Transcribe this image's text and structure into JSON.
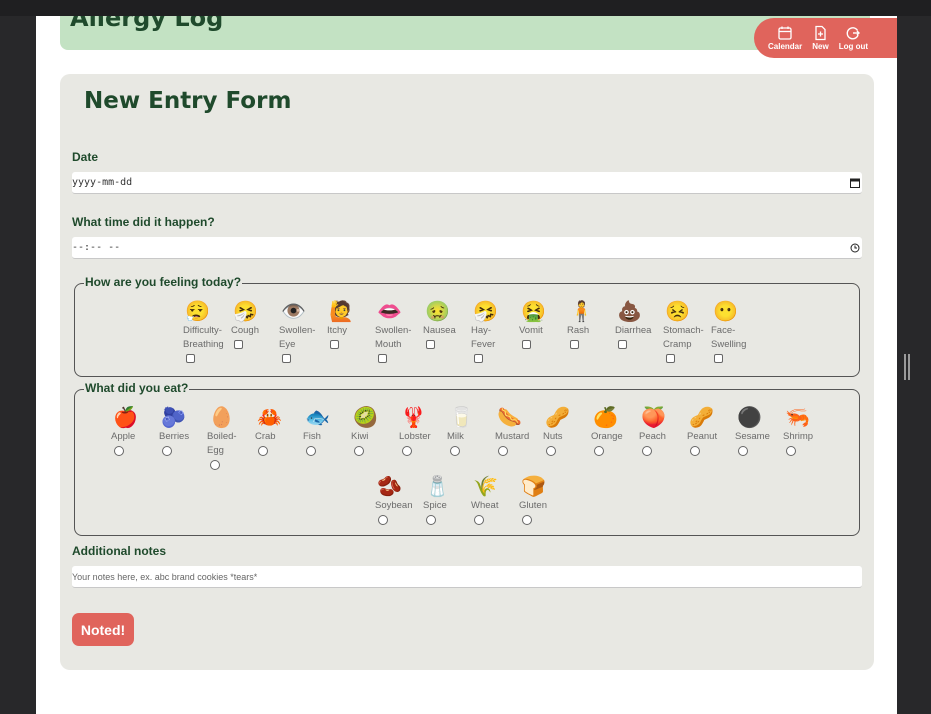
{
  "header": {
    "title": "Allergy Log"
  },
  "nav": [
    {
      "label": "Calendar",
      "icon": "calendar-icon"
    },
    {
      "label": "New",
      "icon": "new-entry-icon"
    },
    {
      "label": "Log out",
      "icon": "logout-icon"
    }
  ],
  "form": {
    "title": "New Entry Form",
    "date_label": "Date",
    "date_value": "yyyy-mm-dd",
    "time_label": "What time did it happen?",
    "time_value": "--:-- --",
    "feelings_legend": "How are you feeling today?",
    "feelings": [
      {
        "label": "Difficulty-Breathing",
        "icon": "difficulty-breathing-icon",
        "emoji": "😮‍💨"
      },
      {
        "label": "Cough",
        "icon": "cough-icon",
        "emoji": "🤧"
      },
      {
        "label": "Swollen-Eye",
        "icon": "swollen-eye-icon",
        "emoji": "👁️"
      },
      {
        "label": "Itchy",
        "icon": "itchy-icon",
        "emoji": "🙋"
      },
      {
        "label": "Swollen-Mouth",
        "icon": "swollen-mouth-icon",
        "emoji": "👄"
      },
      {
        "label": "Nausea",
        "icon": "nausea-icon",
        "emoji": "🤢"
      },
      {
        "label": "Hay-Fever",
        "icon": "hay-fever-icon",
        "emoji": "🤧"
      },
      {
        "label": "Vomit",
        "icon": "vomit-icon",
        "emoji": "🤮"
      },
      {
        "label": "Rash",
        "icon": "rash-icon",
        "emoji": "🧍"
      },
      {
        "label": "Diarrhea",
        "icon": "diarrhea-icon",
        "emoji": "💩"
      },
      {
        "label": "Stomach-Cramp",
        "icon": "stomach-cramp-icon",
        "emoji": "😣"
      },
      {
        "label": "Face-Swelling",
        "icon": "face-swelling-icon",
        "emoji": "😶"
      }
    ],
    "foods_legend": "What did you eat?",
    "foods": [
      {
        "label": "Apple",
        "icon": "apple-icon",
        "emoji": "🍎"
      },
      {
        "label": "Berries",
        "icon": "berries-icon",
        "emoji": "🫐"
      },
      {
        "label": "Boiled-Egg",
        "icon": "boiled-egg-icon",
        "emoji": "🥚"
      },
      {
        "label": "Crab",
        "icon": "crab-icon",
        "emoji": "🦀"
      },
      {
        "label": "Fish",
        "icon": "fish-icon",
        "emoji": "🐟"
      },
      {
        "label": "Kiwi",
        "icon": "kiwi-icon",
        "emoji": "🥝"
      },
      {
        "label": "Lobster",
        "icon": "lobster-icon",
        "emoji": "🦞"
      },
      {
        "label": "Milk",
        "icon": "milk-icon",
        "emoji": "🥛"
      },
      {
        "label": "Mustard",
        "icon": "mustard-icon",
        "emoji": "🌭"
      },
      {
        "label": "Nuts",
        "icon": "nuts-icon",
        "emoji": "🥜"
      },
      {
        "label": "Orange",
        "icon": "orange-icon",
        "emoji": "🍊"
      },
      {
        "label": "Peach",
        "icon": "peach-icon",
        "emoji": "🍑"
      },
      {
        "label": "Peanut",
        "icon": "peanut-icon",
        "emoji": "🥜"
      },
      {
        "label": "Sesame",
        "icon": "sesame-icon",
        "emoji": "⚫"
      },
      {
        "label": "Shrimp",
        "icon": "shrimp-icon",
        "emoji": "🦐"
      },
      {
        "label": "Soybean",
        "icon": "soybean-icon",
        "emoji": "🫘"
      },
      {
        "label": "Spice",
        "icon": "spice-icon",
        "emoji": "🧂"
      },
      {
        "label": "Wheat",
        "icon": "wheat-icon",
        "emoji": "🌾"
      },
      {
        "label": "Gluten",
        "icon": "gluten-icon",
        "emoji": "🍞"
      }
    ],
    "notes_label": "Additional notes",
    "notes_placeholder": "Your notes here, ex. abc brand cookies *tears*",
    "submit_label": "Noted!"
  },
  "colors": {
    "accent": "#e0645c",
    "header_bg": "#c3e2c3",
    "heading_text": "#1f4a2c",
    "card_bg": "#e8e8e3"
  }
}
